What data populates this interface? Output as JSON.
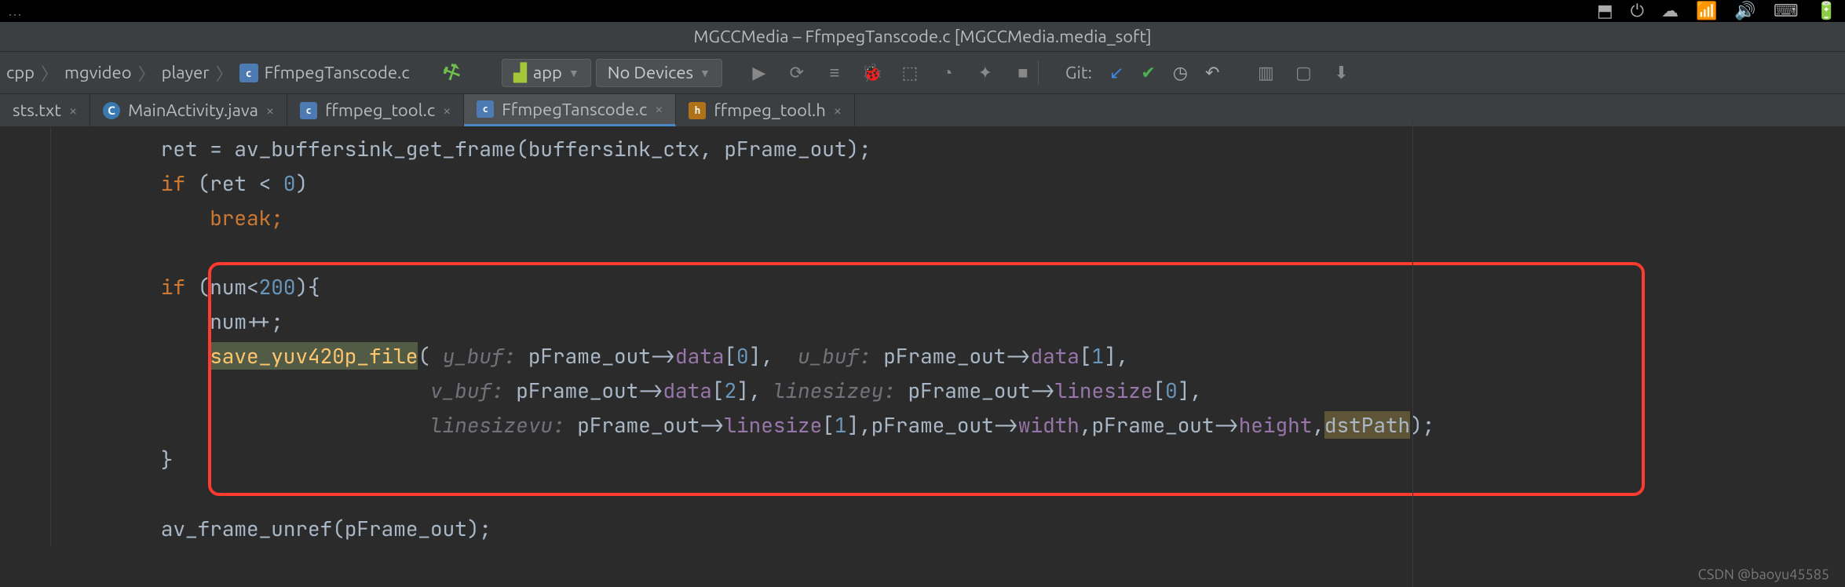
{
  "menubar": {
    "items": [
      "",
      "",
      "",
      "",
      "",
      "",
      "",
      "",
      "",
      "",
      "",
      "",
      ""
    ]
  },
  "title": "MGCCMedia – FfmpegTanscode.c [MGCCMedia.media_soft]",
  "breadcrumb": [
    "cpp",
    "mgvideo",
    "player",
    "FfmpegTanscode.c"
  ],
  "run_config": "app",
  "device": "No Devices",
  "git_label": "Git:",
  "tabs": [
    {
      "label": "sts.txt",
      "active": false,
      "icon": ""
    },
    {
      "label": "MainActivity.java",
      "active": false,
      "icon": "C"
    },
    {
      "label": "ffmpeg_tool.c",
      "active": false,
      "icon": "c"
    },
    {
      "label": "FfmpegTanscode.c",
      "active": true,
      "icon": "c"
    },
    {
      "label": "ffmpeg_tool.h",
      "active": false,
      "icon": "h"
    }
  ],
  "code": {
    "l1a": "        ret = ",
    "l1b": "av_buffersink_get_frame",
    "l1c": "(buffersink_ctx, pFrame_out);",
    "l2a": "        ",
    "l2b": "if",
    "l2c": " (ret < ",
    "l2d": "0",
    "l2e": ")",
    "l3a": "            ",
    "l3b": "break",
    "l3c": ";",
    "l4": "",
    "l5a": "        ",
    "l5b": "if",
    "l5c": " (num<",
    "l5d": "200",
    "l5e": "){",
    "l6": "            num++;",
    "l7a": "            ",
    "l7b": "save_yuv420p_file",
    "l7c": "( ",
    "l7d": "y_buf:",
    "l7e": " pFrame_out->",
    "l7f": "data",
    "l7g": "[",
    "l7h": "0",
    "l7i": "],  ",
    "l7j": "u_buf:",
    "l7k": " pFrame_out->",
    "l7l": "data",
    "l7m": "[",
    "l7n": "1",
    "l7o": "],",
    "l8a": "                              ",
    "l8b": "v_buf:",
    "l8c": " pFrame_out->",
    "l8d": "data",
    "l8e": "[",
    "l8f": "2",
    "l8g": "], ",
    "l8h": "linesizey:",
    "l8i": " pFrame_out->",
    "l8j": "linesize",
    "l8k": "[",
    "l8l": "0",
    "l8m": "],",
    "l9a": "                              ",
    "l9b": "linesizevu:",
    "l9c": " pFrame_out->",
    "l9d": "linesize",
    "l9e": "[",
    "l9f": "1",
    "l9g": "],pFrame_out->",
    "l9h": "width",
    "l9i": ",pFrame_out->",
    "l9j": "height",
    "l9k": ",",
    "l9l": "dstPath",
    "l9m": ");",
    "l10": "        }",
    "l11": "",
    "l12a": "        ",
    "l12b": "av_frame_unref",
    "l12c": "(pFrame_out);"
  },
  "watermark": "CSDN @baoyu45585"
}
